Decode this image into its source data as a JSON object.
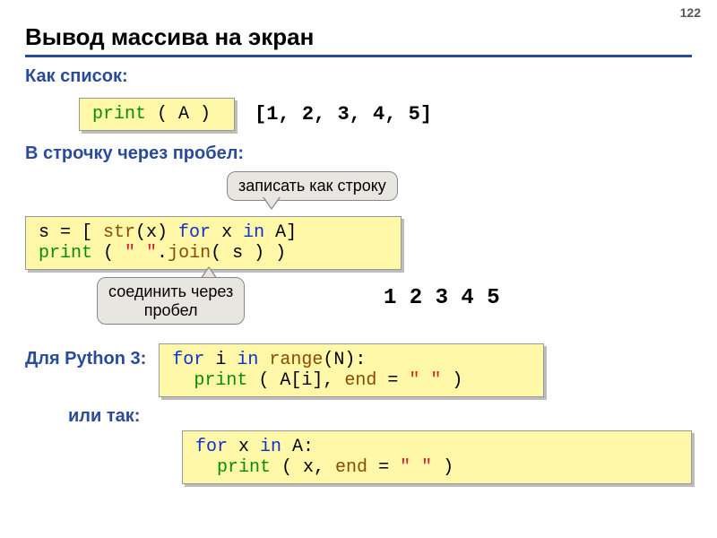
{
  "page_number": "122",
  "title": "Вывод массива на экран",
  "labels": {
    "as_list": "Как список:",
    "inline_space": "В строчку через пробел:",
    "for_python3": "Для Python 3:",
    "or_so": "или так:"
  },
  "callouts": {
    "as_string": "записать как строку",
    "join_space_l1": "соединить через",
    "join_space_l2": "пробел"
  },
  "code": {
    "print_a_print": "print",
    "print_a_rest": " ( A ) ",
    "output_list": "[1, 2, 3, 4, 5]",
    "join_line1_pre": "s = [ ",
    "join_line1_str": "str",
    "join_line1_mid": "(x) ",
    "join_line1_for": "for",
    "join_line1_x": " x ",
    "join_line1_in": "in",
    "join_line1_end": " A]",
    "join_line2_print": "print",
    "join_line2_mid1": " ( ",
    "join_line2_qq": "\" \"",
    "join_line2_dot": ".",
    "join_line2_join": "join",
    "join_line2_end": "( s ) )",
    "output_inline": "1 2 3 4 5",
    "py3a_for": "for",
    "py3a_l1": " i ",
    "py3a_in": "in",
    "py3a_l2": " ",
    "py3a_range": "range",
    "py3a_l3": "(N):",
    "py3a_l4_indent": "  ",
    "py3a_print": "print",
    "py3a_l5": " ( A[i], ",
    "py3a_end": "end",
    "py3a_l6": " = ",
    "py3a_qq": "\" \"",
    "py3a_l7": " )",
    "py3b_for": "for",
    "py3b_l1": " x ",
    "py3b_in": "in",
    "py3b_l2": " A:",
    "py3b_l3_indent": "  ",
    "py3b_print": "print",
    "py3b_l4": " ( x, ",
    "py3b_end": "end",
    "py3b_l5": " = ",
    "py3b_qq": "\" \"",
    "py3b_l6": " )"
  }
}
